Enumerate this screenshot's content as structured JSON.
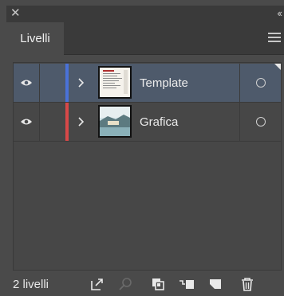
{
  "panel": {
    "close_glyph": "✕",
    "collapse_glyph": "‹‹",
    "tab_label": "Livelli",
    "menu_icon": "hamburger-menu-icon"
  },
  "layers": [
    {
      "name": "Template",
      "color": "#4a72d8",
      "visible": true,
      "selected": true,
      "thumbnail": "document-page"
    },
    {
      "name": "Grafica",
      "color": "#d84848",
      "visible": true,
      "selected": false,
      "thumbnail": "photo-landscape"
    }
  ],
  "footer": {
    "layer_count": "2 livelli",
    "icons": [
      "export-icon",
      "search-icon",
      "clipping-mask-icon",
      "sublayer-icon",
      "new-layer-icon",
      "delete-icon"
    ]
  },
  "colors": {
    "panel_bg": "#4a4a4a",
    "header_bg": "#3a3a3a",
    "selected_row": "#4e5a6b"
  }
}
